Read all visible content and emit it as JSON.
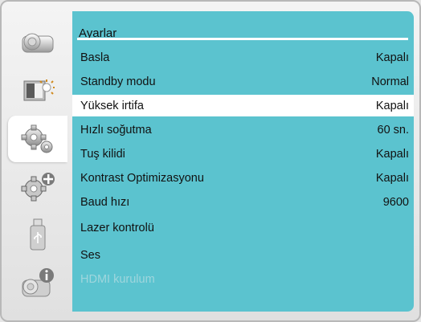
{
  "header": {
    "title": "Ayarlar"
  },
  "sidebar": {
    "items": [
      {
        "icon": "projector-icon"
      },
      {
        "icon": "display-brightness-icon"
      },
      {
        "icon": "gear-settings-icon",
        "active": true
      },
      {
        "icon": "advanced-settings-icon"
      },
      {
        "icon": "usb-icon"
      },
      {
        "icon": "projector-info-icon"
      }
    ]
  },
  "menu": {
    "rows": [
      {
        "label": "Basla",
        "value": "Kapalı"
      },
      {
        "label": "Standby modu",
        "value": "Normal"
      },
      {
        "label": "Yüksek irtifa",
        "value": "Kapalı",
        "selected": true
      },
      {
        "label": "Hızlı soğutma",
        "value": "60 sn."
      },
      {
        "label": "Tuş kilidi",
        "value": "Kapalı"
      },
      {
        "label": "Kontrast Optimizasyonu",
        "value": "Kapalı"
      },
      {
        "label": "Baud hızı",
        "value": "9600"
      },
      {
        "label": "Lazer kontrolü",
        "value": ""
      },
      {
        "label": "Ses",
        "value": ""
      },
      {
        "label": "HDMI kurulum",
        "value": "",
        "disabled": true
      }
    ]
  },
  "colors": {
    "panel": "#5bc3cf",
    "selected_row": "#ffffff",
    "disabled_text": "#9fd6dd"
  }
}
